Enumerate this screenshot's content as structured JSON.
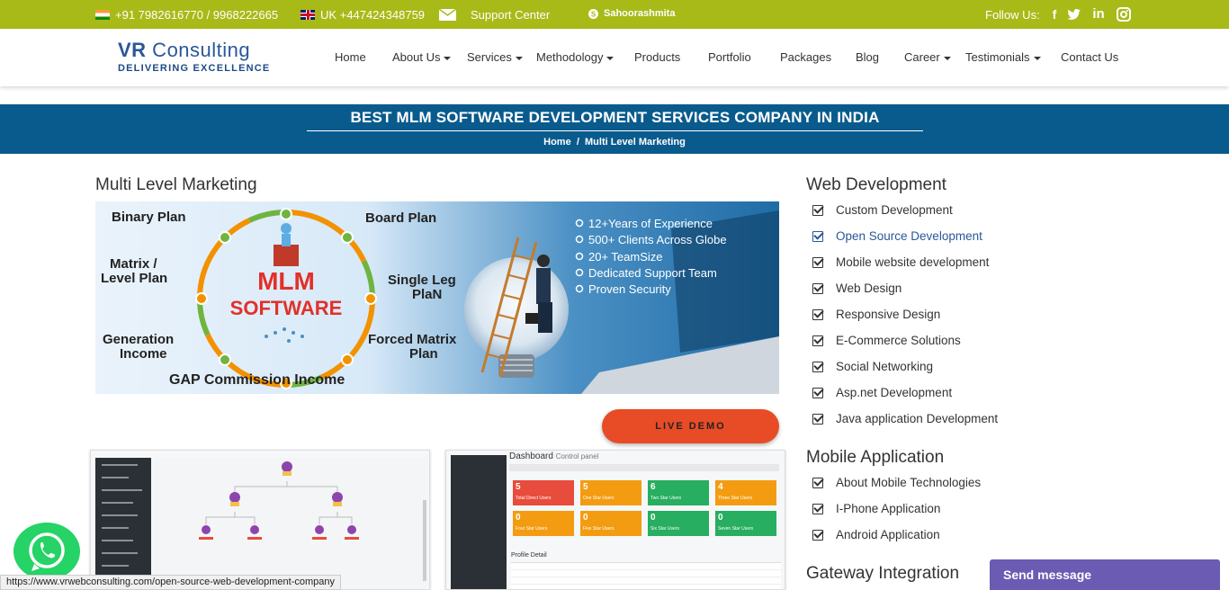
{
  "topbar": {
    "phone_india": "+91 7982616770 / 9968222665",
    "phone_uk": "UK +447424348759",
    "support": "Support Center",
    "skype": "Sahoorashmita",
    "follow": "Follow Us:",
    "bg_color": "#a8ba18"
  },
  "logo": {
    "line1_bold": "VR",
    "line1_rest": " Consulting",
    "line2": "DELIVERING EXCELLENCE"
  },
  "nav": {
    "home": "Home",
    "about": "About Us",
    "services": "Services",
    "methodology": "Methodology",
    "products": "Products",
    "portfolio": "Portfolio",
    "packages": "Packages",
    "blog": "Blog",
    "career": "Career",
    "testimonials": "Testimonials",
    "contact": "Contact Us"
  },
  "banner": {
    "title": "BEST MLM SOFTWARE DEVELOPMENT SERVICES COMPANY IN INDIA",
    "crumb_home": "Home",
    "crumb_sep": "/",
    "crumb_current": "Multi Level Marketing",
    "bg_color": "#0a5b8d"
  },
  "main": {
    "title": "Multi Level Marketing",
    "hero": {
      "binary": "Binary Plan",
      "board": "Board Plan",
      "matrix": "Matrix /",
      "level": "Level Plan",
      "single1": "Single Leg",
      "single2": "PlaN",
      "generation1": "Generation",
      "generation2": "Income",
      "forced1": "Forced Matrix",
      "forced2": "Plan",
      "gap": "GAP Commission Income",
      "mlm": "MLM",
      "software": "SOFTWARE",
      "bullets": [
        "12+Years of Experience",
        "500+ Clients Across Globe",
        "20+ TeamSize",
        "Dedicated Support Team",
        "Proven Security"
      ]
    },
    "live_demo": "LIVE DEMO"
  },
  "thumb2": {
    "title": "Dashboard",
    "sub": "Control panel",
    "profile": "Profile Detail",
    "cards": [
      {
        "num": "5",
        "label": "Total Direct Users",
        "color": "#e74c3c"
      },
      {
        "num": "5",
        "label": "One Star Users",
        "color": "#f39c12"
      },
      {
        "num": "6",
        "label": "Two Star Users",
        "color": "#27ae60"
      },
      {
        "num": "4",
        "label": "Three Star Users",
        "color": "#f39c12"
      },
      {
        "num": "0",
        "label": "Four Star Users",
        "color": "#f39c12"
      },
      {
        "num": "0",
        "label": "Five Star Users",
        "color": "#f39c12"
      },
      {
        "num": "0",
        "label": "Six Star Users",
        "color": "#27ae60"
      },
      {
        "num": "0",
        "label": "Seven Star Users",
        "color": "#27ae60"
      }
    ]
  },
  "sidebar": {
    "web_title": "Web Development",
    "web_items": [
      "Custom Development",
      "Open Source Development",
      "Mobile website development",
      "Web Design",
      "Responsive Design",
      "E-Commerce Solutions",
      "Social Networking",
      "Asp.net Development",
      "Java application Development"
    ],
    "mobile_title": "Mobile Application",
    "mobile_items": [
      "About Mobile Technologies",
      "I-Phone Application",
      "Android Application"
    ],
    "gateway_title": "Gateway Integration"
  },
  "statusbar": "https://www.vrwebconsulting.com/open-source-web-development-company",
  "send_message": "Send message"
}
